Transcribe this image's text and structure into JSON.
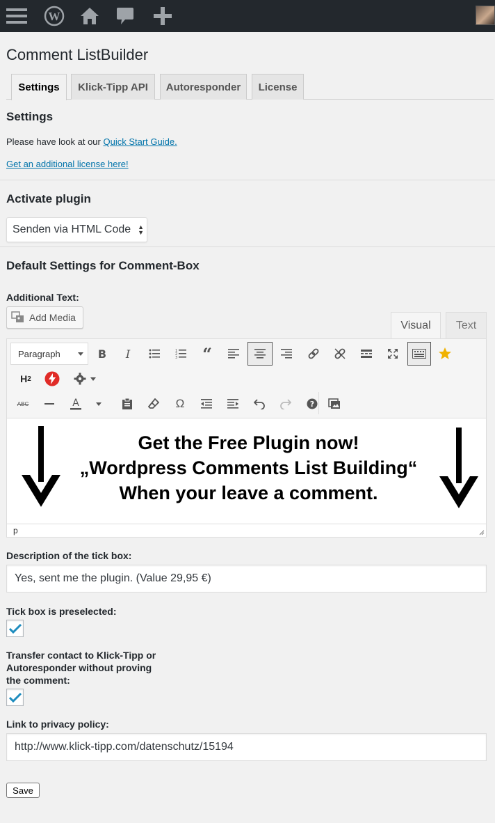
{
  "adminbar": {
    "icons": [
      "menu-icon",
      "wordpress-logo-icon",
      "home-icon",
      "comment-icon",
      "plus-icon"
    ]
  },
  "page": {
    "title": "Comment ListBuilder"
  },
  "tabs": [
    {
      "label": "Settings",
      "active": true
    },
    {
      "label": "Klick-Tipp API",
      "active": false
    },
    {
      "label": "Autoresponder",
      "active": false
    },
    {
      "label": "License",
      "active": false
    }
  ],
  "settings": {
    "heading": "Settings",
    "intro_text": "Please have look at our ",
    "quick_start_link": "Quick Start Guide.",
    "license_link": "Get an additional license here!"
  },
  "activate": {
    "heading": "Activate plugin",
    "selected": "Senden via HTML Code"
  },
  "defaults": {
    "heading": "Default Settings for Comment-Box",
    "additional_text_label": "Additional Text:",
    "add_media_label": "Add Media",
    "editor_tabs": {
      "visual": "Visual",
      "text": "Text"
    },
    "format_select": "Paragraph",
    "promo_lines": [
      "Get the Free Plugin now!",
      "„Wordpress Comments List Building“",
      "When your leave a comment."
    ],
    "status_path": "p"
  },
  "tickbox": {
    "desc_label": "Description of the tick box:",
    "desc_value": "Yes, sent me the plugin. (Value 29,95 €)",
    "preselected_label": "Tick box is preselected:",
    "preselected": true
  },
  "transfer": {
    "label_lines": [
      "Transfer contact to Klick-Tipp or",
      "Autoresponder without proving",
      "the comment:"
    ],
    "checked": true
  },
  "privacy": {
    "label": "Link to privacy policy:",
    "value": "http://www.klick-tipp.com/datenschutz/15194"
  },
  "save_label": "Save",
  "colors": {
    "adminbar": "#23282d",
    "link": "#0073aa",
    "check": "#1e8cbe",
    "star": "#f0b200",
    "red": "#e02b27"
  }
}
